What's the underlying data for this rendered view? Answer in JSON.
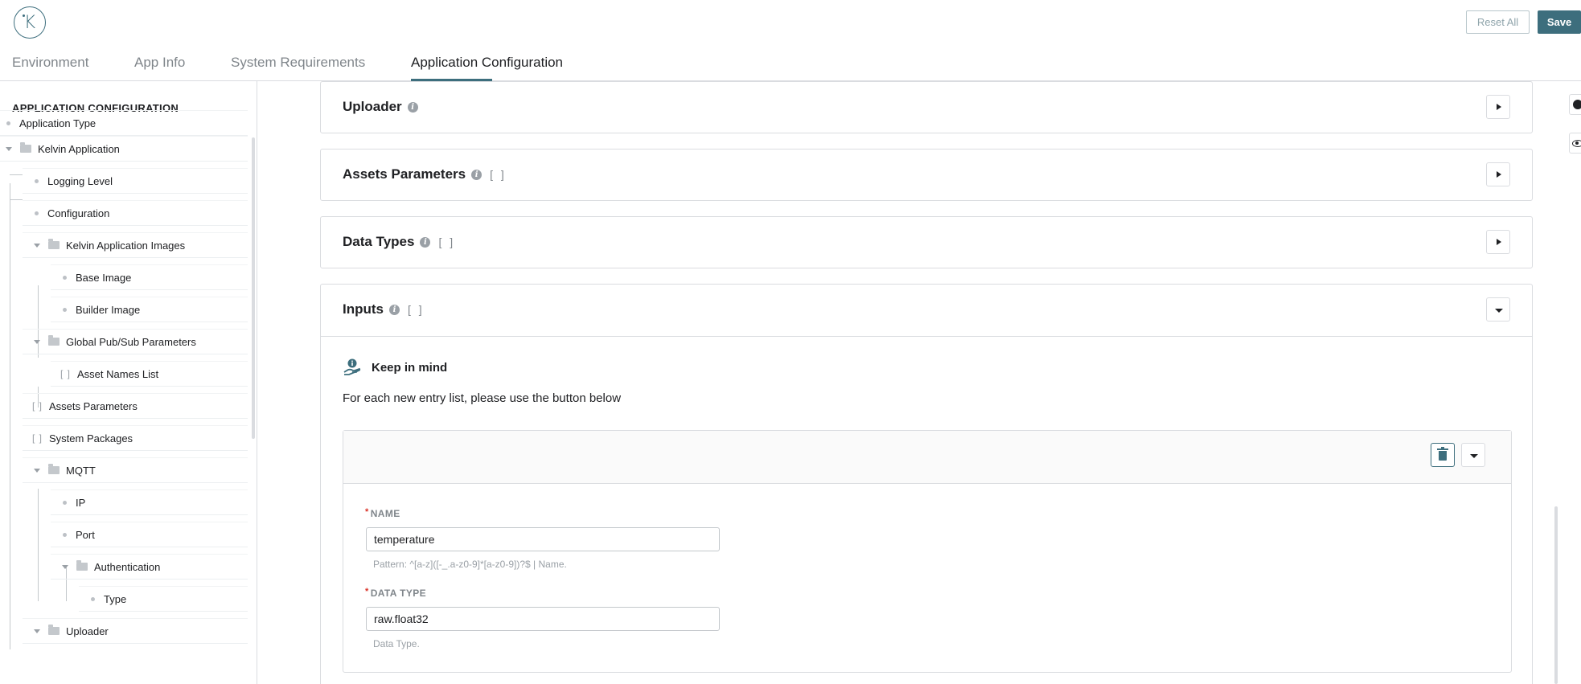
{
  "header": {
    "logo_letter": "K",
    "reset_label": "Reset All",
    "save_label": "Save"
  },
  "tabs": [
    {
      "label": "Environment"
    },
    {
      "label": "App Info"
    },
    {
      "label": "System Requirements"
    },
    {
      "label": "Application Configuration"
    }
  ],
  "sidebar": {
    "title": "APPLICATION CONFIGURATION",
    "items": [
      {
        "label": "Application Type"
      },
      {
        "label": "Kelvin Application"
      },
      {
        "label": "Logging Level"
      },
      {
        "label": "Configuration"
      },
      {
        "label": "Kelvin Application Images"
      },
      {
        "label": "Base Image"
      },
      {
        "label": "Builder Image"
      },
      {
        "label": "Global Pub/Sub Parameters"
      },
      {
        "label": "Asset Names List"
      },
      {
        "label": "Assets Parameters"
      },
      {
        "label": "System Packages"
      },
      {
        "label": "MQTT"
      },
      {
        "label": "IP"
      },
      {
        "label": "Port"
      },
      {
        "label": "Authentication"
      },
      {
        "label": "Type"
      },
      {
        "label": "Uploader"
      }
    ]
  },
  "sections": [
    {
      "title": "Uploader",
      "brackets": ""
    },
    {
      "title": "Assets Parameters",
      "brackets": "[ ]"
    },
    {
      "title": "Data Types",
      "brackets": "[ ]"
    },
    {
      "title": "Inputs",
      "brackets": "[ ]"
    }
  ],
  "inputs_panel": {
    "keep_in_mind_title": "Keep in mind",
    "keep_in_mind_desc": "For each new entry list, please use the button below",
    "entry": {
      "name_label": "NAME",
      "name_value": "temperature",
      "name_hint": "Pattern: ^[a-z]([-_.a-z0-9]*[a-z0-9])?$ | Name.",
      "type_label": "DATA TYPE",
      "type_value": "raw.float32",
      "type_hint": "Data Type."
    }
  },
  "colors": {
    "accent": "#3d6e7d",
    "border": "#dadce0",
    "required": "#d93025"
  }
}
